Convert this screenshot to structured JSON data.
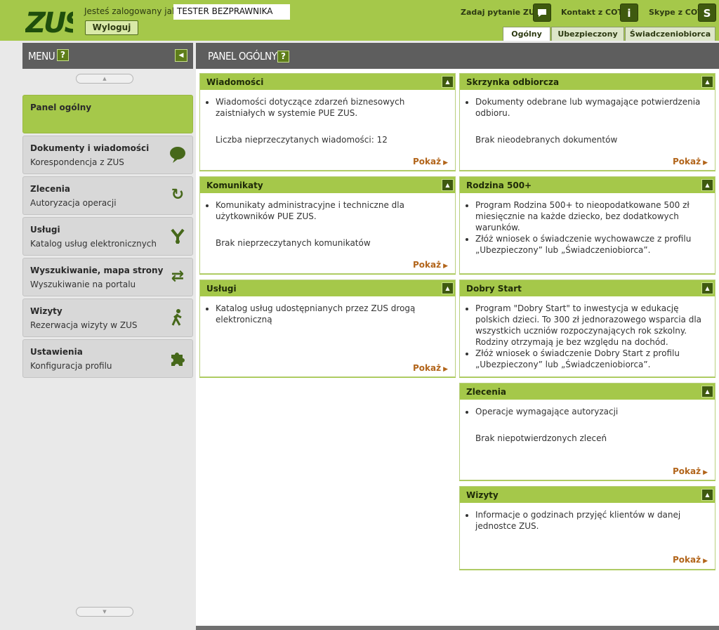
{
  "header": {
    "logo_text": "ZUS",
    "logged_in_as": "Jesteś zalogowany jako",
    "user_name": "TESTER BEZPRAWNIKA",
    "logout_label": "Wyloguj",
    "ask_question": "Zadaj pytanie ZUS",
    "contact_cot": "Kontakt z COT",
    "skype_cot": "Skype z COT",
    "tabs": [
      "Ogólny",
      "Ubezpieczony",
      "Świadczeniobiorca"
    ]
  },
  "menu": {
    "title": "MENU",
    "help": "?",
    "items": [
      {
        "title": "Panel ogólny",
        "sub": ""
      },
      {
        "title": "Dokumenty i wiadomości",
        "sub": "Korespondencja z ZUS",
        "icon": "speech-bubble-icon"
      },
      {
        "title": "Zlecenia",
        "sub": "Autoryzacja operacji",
        "icon": "refresh-icon"
      },
      {
        "title": "Usługi",
        "sub": "Katalog usług elektronicznych",
        "icon": "branch-icon"
      },
      {
        "title": "Wyszukiwanie, mapa strony",
        "sub": "Wyszukiwanie na portalu",
        "icon": "sync-icon"
      },
      {
        "title": "Wizyty",
        "sub": "Rezerwacja wizyty w ZUS",
        "icon": "walking-person-icon"
      },
      {
        "title": "Ustawienia",
        "sub": "Konfiguracja profilu",
        "icon": "puzzle-icon"
      }
    ]
  },
  "panel": {
    "title": "PANEL OGÓLNY",
    "show_label": "Pokaż",
    "cards": {
      "wiadomosci": {
        "title": "Wiadomości",
        "bullets": [
          "Wiadomości dotyczące zdarzeń biznesowych zaistniałych w systemie PUE ZUS."
        ],
        "note": "Liczba nieprzeczytanych wiadomości: 12"
      },
      "skrzynka": {
        "title": "Skrzynka odbiorcza",
        "bullets": [
          "Dokumenty odebrane lub wymagające potwierdzenia odbioru."
        ],
        "note": "Brak nieodebranych dokumentów"
      },
      "komunikaty": {
        "title": "Komunikaty",
        "bullets": [
          "Komunikaty administracyjne i techniczne dla użytkowników PUE ZUS."
        ],
        "note": "Brak nieprzeczytanych komunikatów"
      },
      "rodzina": {
        "title": "Rodzina 500+",
        "bullets": [
          "Program Rodzina 500+ to nieopodatkowane 500 zł miesięcznie na każde dziecko, bez dodatkowych warunków.",
          "Złóż wniosek o świadczenie wychowawcze z profilu „Ubezpieczony” lub „Świadczeniobiorca”."
        ]
      },
      "uslugi": {
        "title": "Usługi",
        "bullets": [
          "Katalog usług udostępnianych przez ZUS drogą elektroniczną"
        ]
      },
      "dobry_start": {
        "title": "Dobry Start",
        "bullets": [
          "Program \"Dobry Start\" to inwestycja w edukację polskich dzieci. To 300 zł jednorazowego wsparcia dla wszystkich uczniów rozpoczynających rok szkolny. Rodziny otrzymają je bez względu na dochód.",
          "Złóż wniosek o świadczenie Dobry Start z profilu „Ubezpieczony” lub „Świadczeniobiorca”."
        ]
      },
      "zlecenia": {
        "title": "Zlecenia",
        "bullets": [
          "Operacje wymagające autoryzacji"
        ],
        "note": "Brak niepotwierdzonych zleceń"
      },
      "wizyty": {
        "title": "Wizyty",
        "bullets": [
          "Informacje o godzinach przyjęć klientów w danej jednostce ZUS."
        ]
      }
    }
  }
}
